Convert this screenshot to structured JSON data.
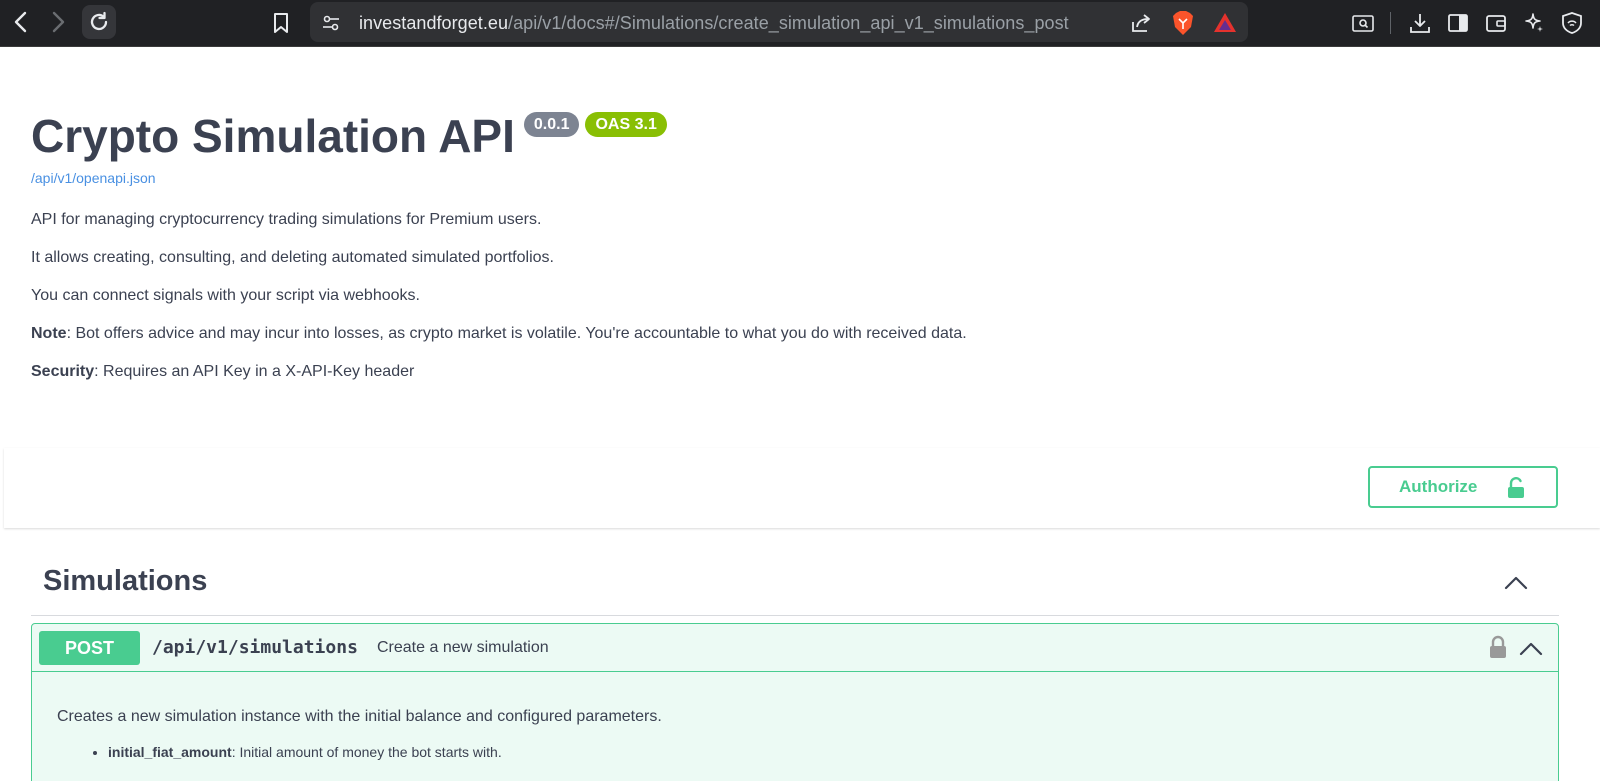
{
  "browser": {
    "url_host": "investandforget.eu",
    "url_path": "/api/v1/docs#/Simulations/create_simulation_api_v1_simulations_post"
  },
  "info": {
    "title": "Crypto Simulation API",
    "version_badge": "0.0.1",
    "oas_badge": "OAS 3.1",
    "spec_link": "/api/v1/openapi.json",
    "desc_1": "API for managing cryptocurrency trading simulations for Premium users.",
    "desc_2": "It allows creating, consulting, and deleting automated simulated portfolios.",
    "desc_3": "You can connect signals with your script via webhooks.",
    "note_label": "Note",
    "note_text": ": Bot offers advice and may incur into losses, as crypto market is volatile. You're accountable to what you do with received data.",
    "security_label": "Security",
    "security_text": ": Requires an API Key in a X-API-Key header"
  },
  "authorize": {
    "label": "Authorize"
  },
  "tag": {
    "title": "Simulations"
  },
  "operation": {
    "method": "POST",
    "path": "/api/v1/simulations",
    "summary": "Create a new simulation",
    "description": "Creates a new simulation instance with the initial balance and configured parameters.",
    "params": [
      {
        "name": "initial_fiat_amount",
        "text": ": Initial amount of money the bot starts with."
      }
    ]
  },
  "colors": {
    "post_green": "#49cc90",
    "version_badge": "#7d8492",
    "oas_badge": "#89bf04",
    "link_blue": "#4990e2",
    "text": "#3b4151"
  },
  "icons": [
    "back-icon",
    "forward-icon",
    "reload-icon",
    "bookmark-icon",
    "site-info-icon",
    "share-icon",
    "brave-shields-icon",
    "brave-rewards-icon",
    "search-in-page-icon",
    "download-icon",
    "sidebar-icon",
    "wallet-icon",
    "leo-ai-icon",
    "vpn-icon",
    "lock-icon",
    "chevron-up-icon"
  ]
}
